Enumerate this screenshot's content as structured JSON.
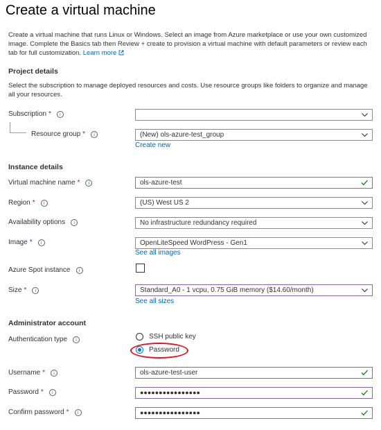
{
  "page": {
    "title": "Create a virtual machine",
    "intro": "Create a virtual machine that runs Linux or Windows. Select an image from Azure marketplace or use your own customized image. Complete the Basics tab then Review + create to provision a virtual machine with default parameters or review each tab for full customization.",
    "learn_more": "Learn more",
    "colors": {
      "link": "#0067b8",
      "required": "#a4262c",
      "valid_check": "#107c10",
      "highlight_ring": "#e81123",
      "field_focus": "#8764b8"
    }
  },
  "project": {
    "heading": "Project details",
    "description": "Select the subscription to manage deployed resources and costs. Use resource groups like folders to organize and manage all your resources.",
    "subscription_label": "Subscription",
    "subscription_value": "",
    "resource_group_label": "Resource group",
    "resource_group_value": "(New) ols-azure-test_group",
    "create_new": "Create new"
  },
  "instance": {
    "heading": "Instance details",
    "vm_name_label": "Virtual machine name",
    "vm_name_value": "ols-azure-test",
    "region_label": "Region",
    "region_value": "(US) West US 2",
    "availability_label": "Availability options",
    "availability_value": "No infrastructure redundancy required",
    "image_label": "Image",
    "image_value": "OpenLiteSpeed WordPress - Gen1",
    "see_all_images": "See all images",
    "spot_label": "Azure Spot instance",
    "size_label": "Size",
    "size_value": "Standard_A0 - 1 vcpu, 0.75 GiB memory ($14.60/month)",
    "see_all_sizes": "See all sizes"
  },
  "admin": {
    "heading": "Administrator account",
    "auth_label": "Authentication type",
    "auth_options": [
      "SSH public key",
      "Password"
    ],
    "auth_selected": "Password",
    "username_label": "Username",
    "username_value": "ols-azure-test-user",
    "password_label": "Password",
    "password_value": "●●●●●●●●●●●●●●●●",
    "confirm_label": "Confirm password",
    "confirm_value": "●●●●●●●●●●●●●●●●"
  },
  "common": {
    "required_marker": "*",
    "info_glyph": "i"
  }
}
